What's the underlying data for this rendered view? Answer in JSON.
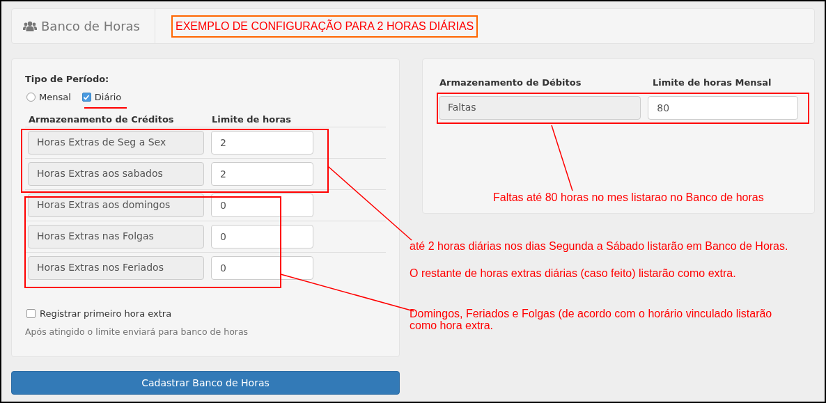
{
  "header": {
    "title": "Banco de Horas",
    "note": "EXEMPLO DE CONFIGURAÇÃO PARA 2 HORAS DIÁRIAS"
  },
  "period": {
    "label": "Tipo de Período:",
    "options": [
      {
        "label": "Mensal",
        "kind": "radio",
        "checked": false
      },
      {
        "label": "Diário",
        "kind": "checkbox",
        "checked": true
      }
    ]
  },
  "credits": {
    "columns": [
      "Armazenamento de Créditos",
      "Limite de horas"
    ],
    "rows": [
      {
        "label": "Horas Extras de Seg a Sex",
        "value": "2"
      },
      {
        "label": "Horas Extras aos sabados",
        "value": "2"
      },
      {
        "label": "Horas Extras aos domingos",
        "value": "0"
      },
      {
        "label": "Horas Extras nas Folgas",
        "value": "0"
      },
      {
        "label": "Horas Extras nos Feriados",
        "value": "0"
      }
    ]
  },
  "register": {
    "label": "Registrar primeiro hora extra",
    "checked": false,
    "help": "Após atingido o limite enviará para banco de horas"
  },
  "debits": {
    "columns": [
      "Armazenamento de Débitos",
      "Limite de horas Mensal"
    ],
    "rows": [
      {
        "label": "Faltas",
        "value": "80"
      }
    ]
  },
  "notes": {
    "debits": "Faltas até 80 horas no mes listarao no Banco de horas",
    "credits": [
      "até 2 horas diárias nos dias Segunda a Sábado listarão em Banco de Horas.",
      "O restante de horas extras diárias (caso feito) listarão como extra.",
      "Domingos, Feriados e Folgas (de acordo com o horário vinculado listarão como hora extra."
    ]
  },
  "submit_button": "Cadastrar Banco de Horas"
}
